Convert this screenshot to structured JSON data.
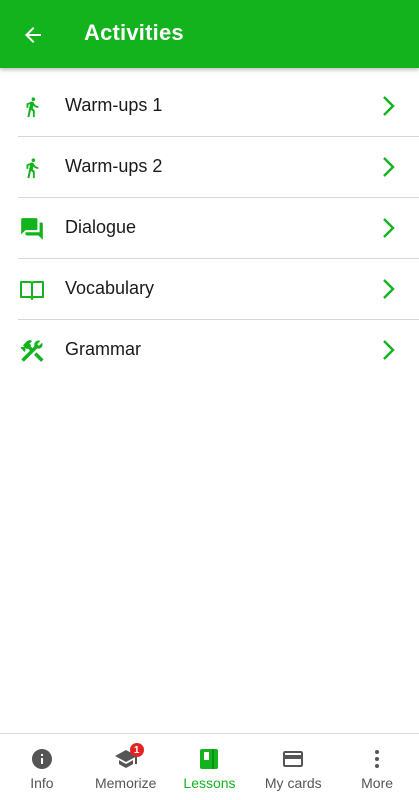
{
  "colors": {
    "primary": "#12b31d",
    "badge": "#e32222",
    "inactive": "#555555"
  },
  "header": {
    "title": "Activities",
    "back_icon": "arrow-left-icon"
  },
  "activities": [
    {
      "label": "Warm-ups 1",
      "icon": "walking-person-icon"
    },
    {
      "label": "Warm-ups 2",
      "icon": "walking-person-icon"
    },
    {
      "label": "Dialogue",
      "icon": "chat-bubbles-icon"
    },
    {
      "label": "Vocabulary",
      "icon": "open-book-icon"
    },
    {
      "label": "Grammar",
      "icon": "tools-icon"
    }
  ],
  "bottom_nav": {
    "items": [
      {
        "label": "Info",
        "icon": "info-icon",
        "active": false
      },
      {
        "label": "Memorize",
        "icon": "graduation-cap-icon",
        "active": false,
        "badge": "1"
      },
      {
        "label": "Lessons",
        "icon": "book-icon",
        "active": true
      },
      {
        "label": "My cards",
        "icon": "credit-card-icon",
        "active": false
      },
      {
        "label": "More",
        "icon": "more-vertical-icon",
        "active": false
      }
    ]
  }
}
